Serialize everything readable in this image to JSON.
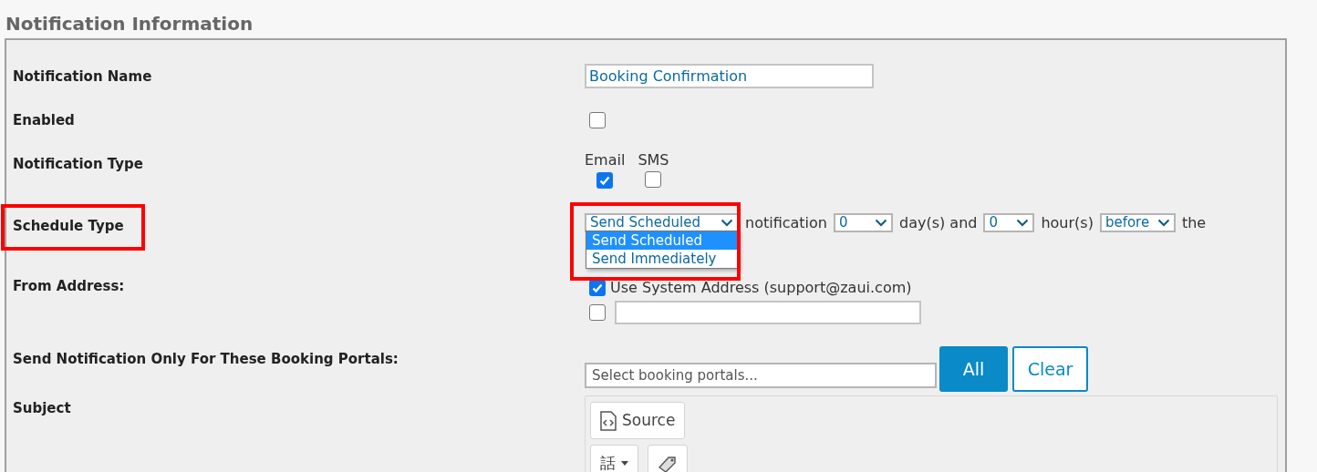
{
  "heading": "Notification Information",
  "fields": [
    {
      "kind": "text",
      "label": "Notification Name",
      "value": "Booking Confirmation"
    },
    {
      "kind": "checkbox",
      "label": "Enabled",
      "checked": false
    },
    {
      "kind": "checkbox_group",
      "label": "Notification Type",
      "options": [
        {
          "label": "Email",
          "checked": true
        },
        {
          "label": "SMS",
          "checked": false
        }
      ]
    },
    {
      "kind": "schedule",
      "label": "Schedule Type",
      "highlighted": true,
      "select": {
        "value": "Send Scheduled",
        "open": true,
        "highlighted": true,
        "options": [
          {
            "label": "Send Scheduled",
            "selected": true
          },
          {
            "label": "Send Immediately",
            "selected": false
          }
        ]
      },
      "parts": [
        {
          "kind": "text",
          "text": "notification"
        },
        {
          "kind": "select",
          "value": "0"
        },
        {
          "kind": "text",
          "text": "day(s) and"
        },
        {
          "kind": "select",
          "value": "0"
        },
        {
          "kind": "text",
          "text": "hour(s)"
        },
        {
          "kind": "select",
          "value": "before"
        },
        {
          "kind": "text",
          "text": "the"
        }
      ]
    },
    {
      "kind": "from_address",
      "label": "From Address:",
      "options": [
        {
          "kind": "system",
          "text": "Use System Address (support@zaui.com)",
          "checked": true
        },
        {
          "kind": "custom",
          "checked": false
        }
      ]
    },
    {
      "kind": "portals",
      "label": "Send Notification Only For These Booking Portals:",
      "placeholder": "Select booking portals...",
      "buttons": [
        {
          "label": "All",
          "primary": true
        },
        {
          "label": "Clear",
          "primary": false
        }
      ]
    },
    {
      "kind": "editor",
      "label": "Subject",
      "toolbar": [
        [
          {
            "kind": "source",
            "label": "Source"
          }
        ],
        [
          {
            "kind": "language",
            "label": "話"
          },
          {
            "kind": "tag"
          }
        ]
      ]
    }
  ]
}
